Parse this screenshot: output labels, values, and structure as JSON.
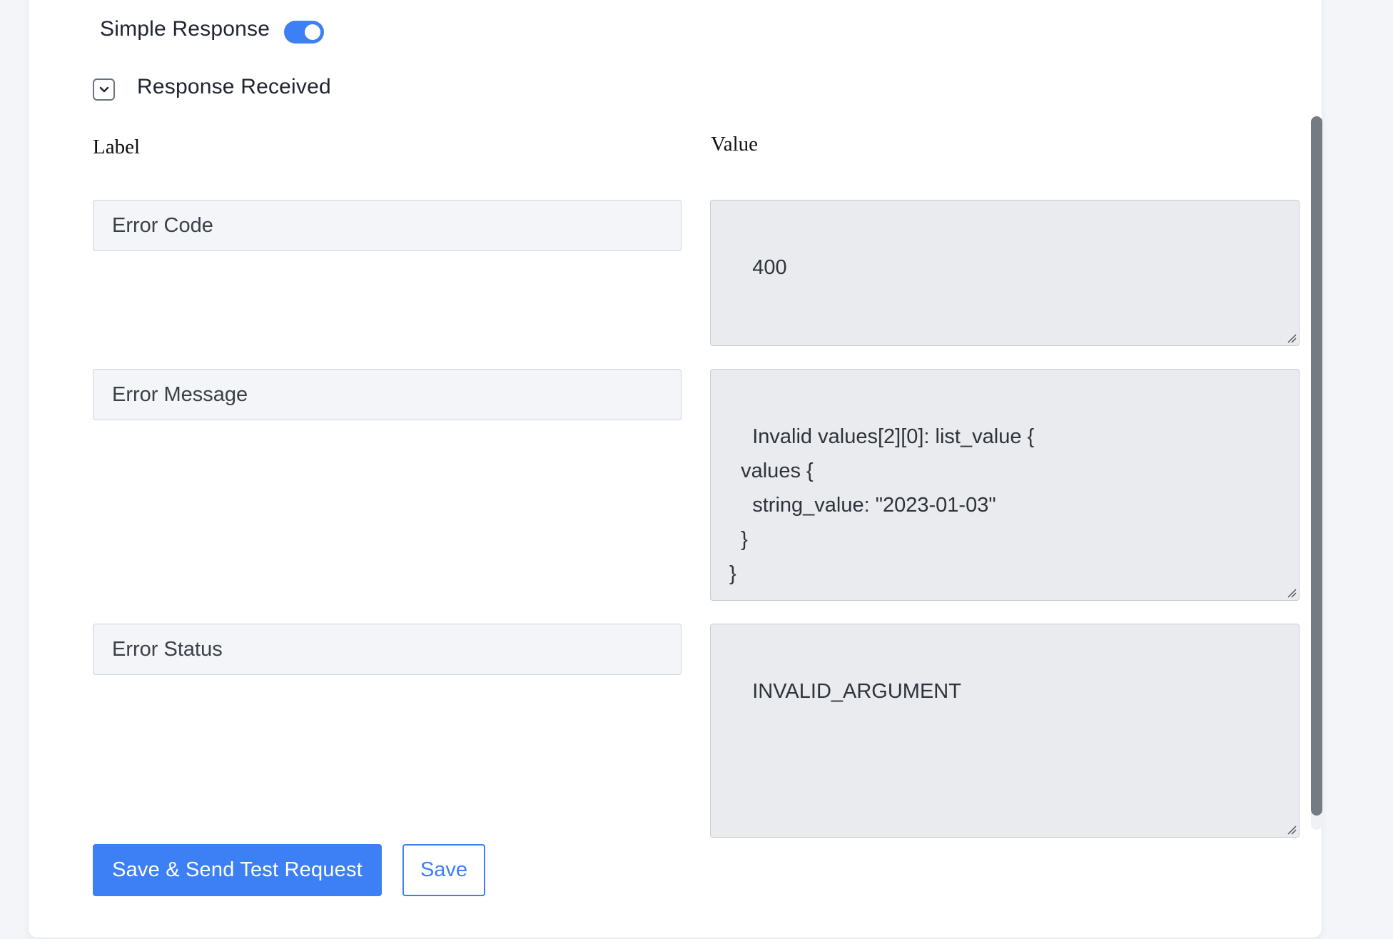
{
  "simple_response": {
    "label": "Simple Response",
    "enabled": true
  },
  "response_section": {
    "title": "Response Received",
    "expanded": true
  },
  "columns": {
    "label_header": "Label",
    "value_header": "Value"
  },
  "rows": [
    {
      "label": "Error Code",
      "value": "400"
    },
    {
      "label": "Error Message",
      "value": "Invalid values[2][0]: list_value {\n  values {\n    string_value: \"2023-01-03\"\n  }\n}"
    },
    {
      "label": "Error Status",
      "value": "INVALID_ARGUMENT"
    }
  ],
  "actions": {
    "save_and_send": "Save & Send Test Request",
    "save": "Save"
  },
  "colors": {
    "accent": "#3d7ff5",
    "scrollbar": "#747b84"
  }
}
